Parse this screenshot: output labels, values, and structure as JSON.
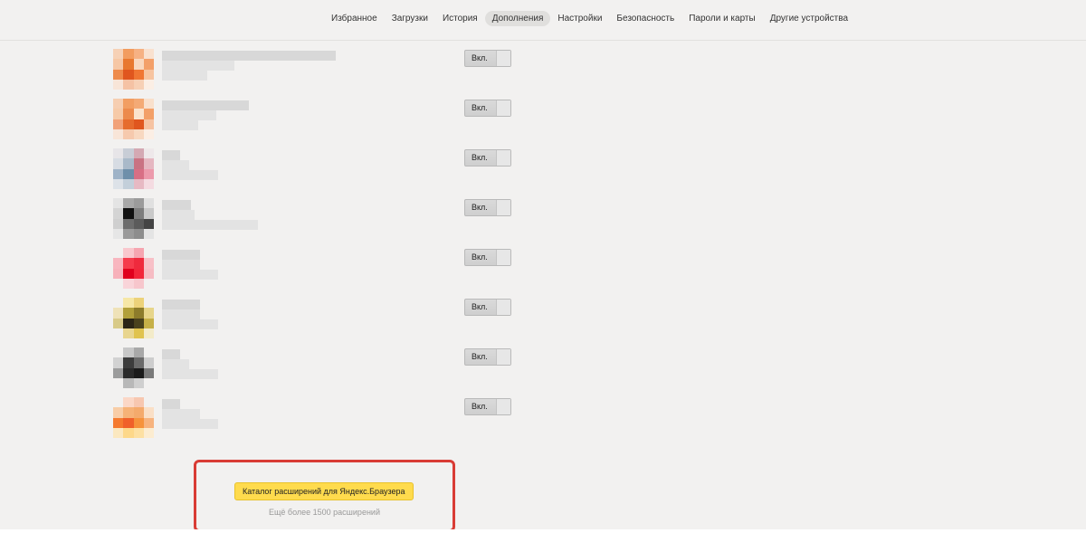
{
  "nav": {
    "items": [
      "Избранное",
      "Загрузки",
      "История",
      "Дополнения",
      "Настройки",
      "Безопасность",
      "Пароли и карты",
      "Другие устройства"
    ],
    "active_index": 3
  },
  "extensions": [
    {
      "toggle_label": "Вкл.",
      "icon_colors": [
        "#f6d1b6",
        "#f29c5f",
        "#f6b183",
        "#f9e1cf",
        "#f6c7a5",
        "#e8782f",
        "#f9d8bf",
        "#f3a06a",
        "#ee8b4c",
        "#e0561e",
        "#f07633",
        "#f7c4a0",
        "#f8e5d8",
        "#f5c2a4",
        "#f7d0b5",
        "#fbeee4"
      ]
    },
    {
      "toggle_label": "Вкл.",
      "icon_colors": [
        "#f6ceb1",
        "#f29e62",
        "#f4aa75",
        "#f9e0cc",
        "#f6caa8",
        "#ec8a4c",
        "#fbe3cc",
        "#f3a068",
        "#f1a27a",
        "#e66b2d",
        "#e0561e",
        "#f6c3a2",
        "#f8e5d8",
        "#f6c9ad",
        "#f8d8c0",
        "#fbeee4"
      ]
    },
    {
      "toggle_label": "Вкл.",
      "icon_colors": [
        "#e7e5e8",
        "#c8cdd6",
        "#d4a9b3",
        "#eee8ea",
        "#d7dce3",
        "#a9b9c9",
        "#c97383",
        "#e5b7c1",
        "#9fb3c7",
        "#6e8faa",
        "#d86f85",
        "#ec9aac",
        "#dde2e8",
        "#c3cfda",
        "#e7b9c3",
        "#f4dbe1"
      ]
    },
    {
      "toggle_label": "Вкл.",
      "icon_colors": [
        "#e4e4e4",
        "#a8a8a8",
        "#9b9b9b",
        "#e0e0e0",
        "#d4d4d4",
        "#111111",
        "#7d7d7d",
        "#c9c9c9",
        "#cfcfcf",
        "#6d6d6d",
        "#5b5b5b",
        "#444444",
        "#e6e6e6",
        "#9a9a9a",
        "#8d8d8d",
        "#e4e4e4"
      ]
    },
    {
      "toggle_label": "Вкл.",
      "icon_colors": [
        "#f2f1f0",
        "#f9c7cd",
        "#f6a5b0",
        "#f2f1f0",
        "#f8b6bf",
        "#f53b4c",
        "#ef2a3d",
        "#f8c0c7",
        "#f7b1ba",
        "#e0001d",
        "#f2263a",
        "#f6bcc3",
        "#f2f1f0",
        "#f9d4d9",
        "#f7c6cc",
        "#f2f1f0"
      ]
    },
    {
      "toggle_label": "Вкл.",
      "icon_colors": [
        "#f2f1f0",
        "#f6e7a6",
        "#ecd27a",
        "#f2f1f0",
        "#efe2b8",
        "#b2a03a",
        "#8d7c2b",
        "#e7d58a",
        "#d8ca88",
        "#2c2616",
        "#4a421d",
        "#c6b048",
        "#f2f1f0",
        "#e8d58f",
        "#e0c34f",
        "#f3ebc9"
      ]
    },
    {
      "toggle_label": "Вкл.",
      "icon_colors": [
        "#f2f1f0",
        "#c7c7c7",
        "#a8a8a8",
        "#f2f1f0",
        "#d2d2d2",
        "#3c3c3c",
        "#6a6a6a",
        "#cdcdcd",
        "#9c9c9c",
        "#2a2a2a",
        "#1a1a1a",
        "#7a7a7a",
        "#f2f1f0",
        "#b8b8b8",
        "#cfcfcf",
        "#f2f1f0"
      ]
    },
    {
      "toggle_label": "Вкл.",
      "icon_colors": [
        "#f2f1f0",
        "#fbd7c6",
        "#f7c7b0",
        "#f2f1f0",
        "#f8cda7",
        "#f6b277",
        "#f4aa6c",
        "#fadfc6",
        "#f57a2f",
        "#f0602a",
        "#f6923b",
        "#f7b37e",
        "#fbe8c0",
        "#fdd88a",
        "#fde0a2",
        "#fcecd0"
      ]
    }
  ],
  "catalog": {
    "button_label": "Каталог расширений для Яндекс.Браузера",
    "subtitle": "Ещё более 1500 расширений"
  },
  "colors": {
    "background": "#f2f1f0",
    "catalog_button": "#ffdb4d",
    "highlight_border": "#d93c35"
  }
}
